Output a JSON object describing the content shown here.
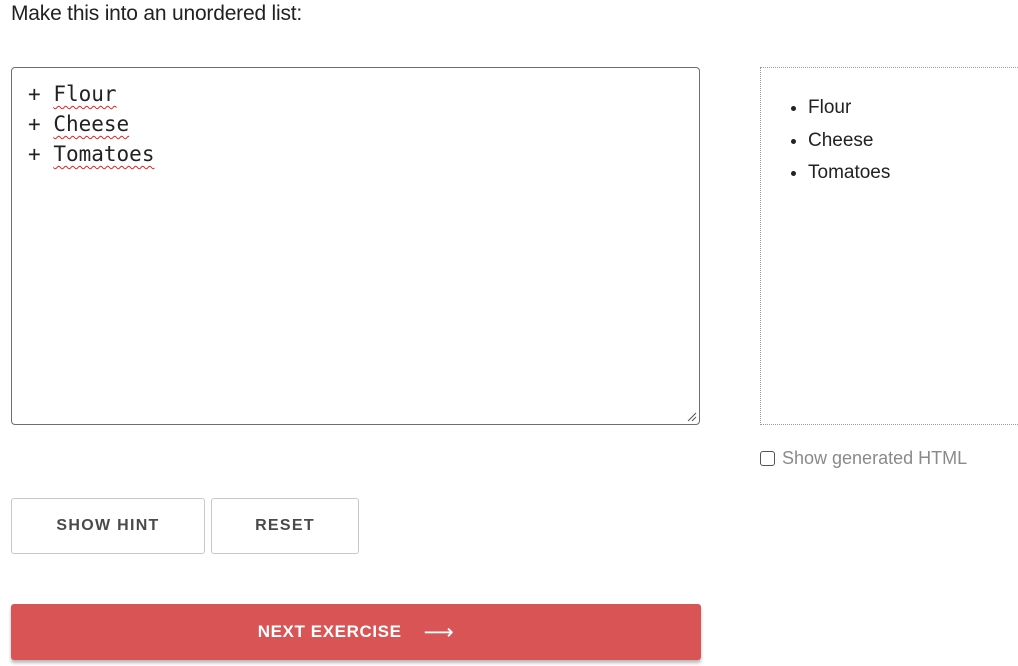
{
  "instruction": "Make this into an unordered list:",
  "editor": {
    "lines": [
      {
        "marker": "+",
        "text": "Flour"
      },
      {
        "marker": "+",
        "text": "Cheese"
      },
      {
        "marker": "+",
        "text": "Tomatoes"
      }
    ]
  },
  "preview": {
    "items": [
      "Flour",
      "Cheese",
      "Tomatoes"
    ]
  },
  "show_html": {
    "label": "Show generated HTML",
    "checked": false
  },
  "buttons": {
    "show_hint": "SHOW HINT",
    "reset": "RESET",
    "next_exercise": "NEXT EXERCISE",
    "next_icon": "arrow-right-icon"
  },
  "colors": {
    "accent": "#d95454",
    "spellcheck": "#e02020",
    "muted_text": "#8a8a8a"
  }
}
